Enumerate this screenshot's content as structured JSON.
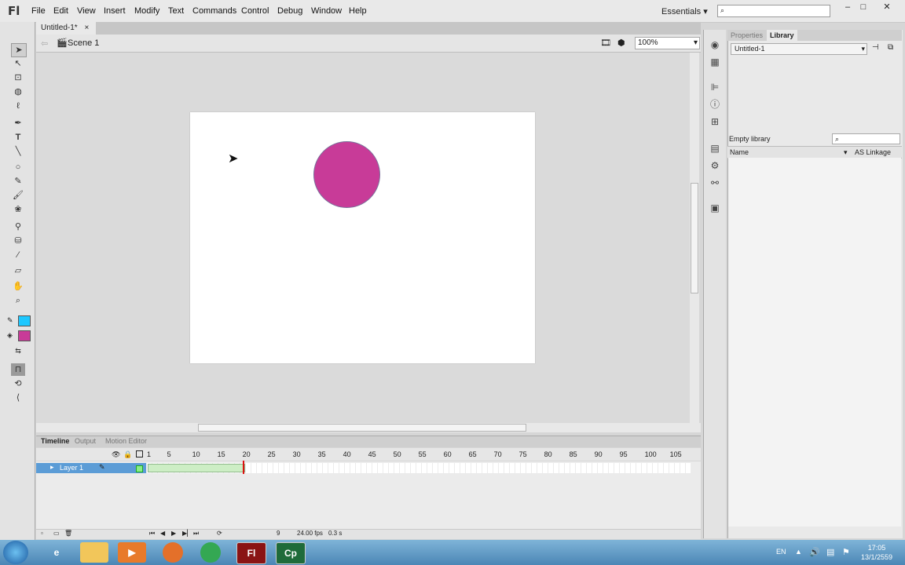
{
  "app": {
    "logo": "Fl"
  },
  "menu": [
    "File",
    "Edit",
    "View",
    "Insert",
    "Modify",
    "Text",
    "Commands",
    "Control",
    "Debug",
    "Window",
    "Help"
  ],
  "workspace": "Essentials",
  "window_controls": [
    "–",
    "□",
    "✕"
  ],
  "document": {
    "tab": "Untitled-1*",
    "close": "×",
    "scene": "Scene 1",
    "zoom": "100%"
  },
  "stage": {
    "circle_color": "#c83b98",
    "fill_color": "#c83b98",
    "stroke_color": "#1ec8ff"
  },
  "timeline": {
    "tabs": [
      "Timeline",
      "Output",
      "Motion Editor"
    ],
    "frame_numbers": [
      "1",
      "5",
      "10",
      "15",
      "20",
      "25",
      "30",
      "35",
      "40",
      "45",
      "50",
      "55",
      "60",
      "65",
      "70",
      "75",
      "80",
      "85",
      "90",
      "95",
      "100",
      "105"
    ],
    "layer": "Layer 1",
    "current_frame": "9",
    "fps": "24.00 fps",
    "time": "0.3 s"
  },
  "library": {
    "tabs": [
      "Properties",
      "Library"
    ],
    "document": "Untitled-1",
    "status": "Empty library",
    "columns": [
      "Name",
      "AS Linkage"
    ]
  },
  "taskbar": {
    "apps": [
      "start",
      "ie",
      "explorer",
      "media",
      "firefox",
      "chrome",
      "flash",
      "captivate"
    ],
    "app_labels": {
      "flash": "Fl",
      "captivate": "Cp"
    },
    "lang": "EN",
    "time": "17:05",
    "date": "13/1/2559"
  }
}
